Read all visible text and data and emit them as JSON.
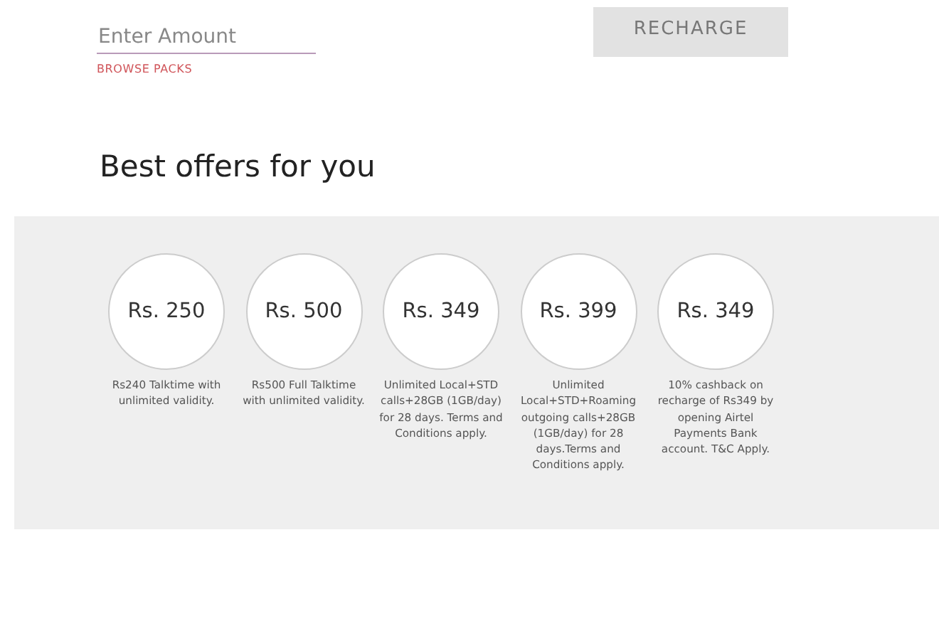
{
  "recharge_form": {
    "amount_placeholder": "Enter Amount",
    "browse_link": "BROWSE PACKS",
    "recharge_button": "RECHARGE"
  },
  "offers_heading": "Best offers for you",
  "offers": [
    {
      "price": "Rs. 250",
      "description": "Rs240 Talktime with unlimited validity."
    },
    {
      "price": "Rs. 500",
      "description": "Rs500 Full Talktime with unlimited validity."
    },
    {
      "price": "Rs. 349",
      "description": "Unlimited Local+STD calls+28GB (1GB/day) for 28 days. Terms and Conditions apply."
    },
    {
      "price": "Rs. 399",
      "description": "Unlimited Local+STD+Roaming outgoing calls+28GB (1GB/day) for 28 days.Terms and Conditions apply."
    },
    {
      "price": "Rs. 349",
      "description": "10% cashback on recharge of Rs349 by opening Airtel Payments Bank account. T&C Apply."
    }
  ]
}
